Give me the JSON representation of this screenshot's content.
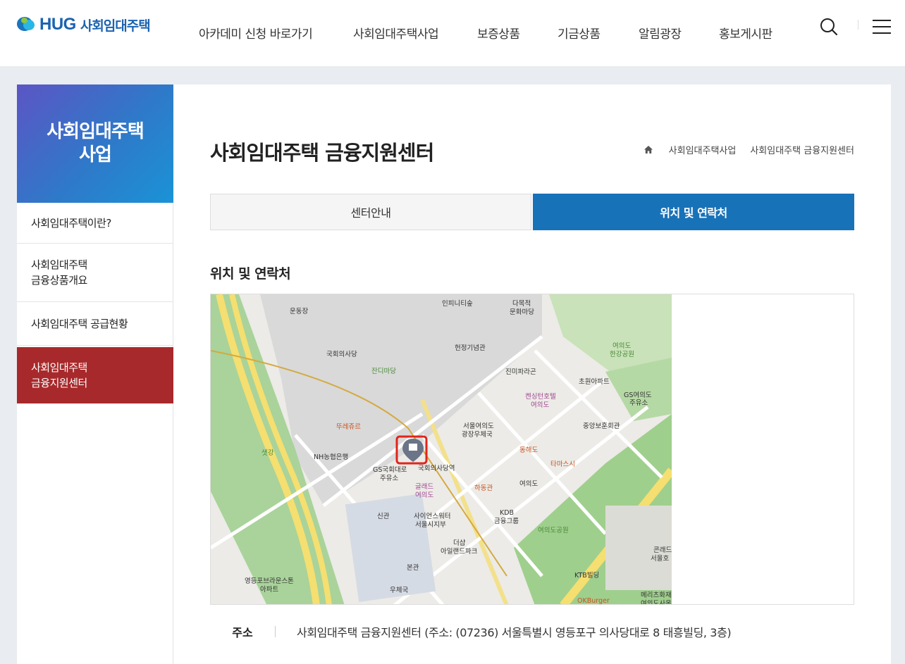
{
  "header": {
    "logo_brand": "HUG",
    "logo_text": "사회임대주택",
    "nav": [
      {
        "label": "아카데미 신청 바로가기"
      },
      {
        "label": "사회임대주택사업"
      },
      {
        "label": "보증상품"
      },
      {
        "label": "기금상품"
      },
      {
        "label": "알림광장"
      },
      {
        "label": "홍보게시판"
      }
    ],
    "icons": {
      "search": "search-icon",
      "menu": "hamburger-menu-icon"
    }
  },
  "sidebar": {
    "title": "사회임대주택\n사업",
    "items": [
      {
        "label": "사회임대주택이란?",
        "active": false
      },
      {
        "label": "사회임대주택\n금융상품개요",
        "active": false
      },
      {
        "label": "사회임대주택 공급현황",
        "active": false
      },
      {
        "label": "사회임대주택\n금융지원센터",
        "active": true
      }
    ],
    "active_color": "#a8292b"
  },
  "main": {
    "page_title": "사회임대주택 금융지원센터",
    "breadcrumb": [
      "사회임대주택사업",
      "사회임대주택 금융지원센터"
    ],
    "tabs": [
      {
        "label": "센터안내",
        "active": false
      },
      {
        "label": "위치 및 연락처",
        "active": true
      }
    ],
    "section_title": "위치 및 연락처",
    "map_labels": {
      "labels": [
        "운동장",
        "인피니티숲",
        "다목적",
        "문화마당",
        "국회의사당",
        "헌정기념관",
        "잔디마당",
        "진미파라곤",
        "켄싱턴호텔",
        "여의도",
        "초원아파트",
        "GS여의도",
        "주유소",
        "여의도",
        "한강공원",
        "중앙보훈회관",
        "뚜레쥬르",
        "서울여의도",
        "광장우체국",
        "동해도",
        "타마스시",
        "NH농협은행",
        "GS국회대로",
        "주유소",
        "국회의사당역",
        "글래드",
        "여의도",
        "하동관",
        "여의도",
        "KDB",
        "금융그룹",
        "신관",
        "사이언스워터",
        "서울시지부",
        "여의도공원",
        "더샵",
        "아일랜드파크",
        "본관",
        "KTB빌딩",
        "콘래드",
        "서울호",
        "영등포브라운스톤",
        "아파트",
        "우체국",
        "OKBurger",
        "메리츠화재",
        "여의도사옥",
        "샛강"
      ]
    },
    "address": {
      "label": "주소",
      "value": "사회임대주택 금융지원센터 (주소: (07236) 서울특별시 영등포구 의사당대로 8 태흥빌딩, 3층)"
    }
  },
  "colors": {
    "brand": "#1b63b0",
    "tab_active": "#1872b8",
    "marker": "#e0251b"
  }
}
